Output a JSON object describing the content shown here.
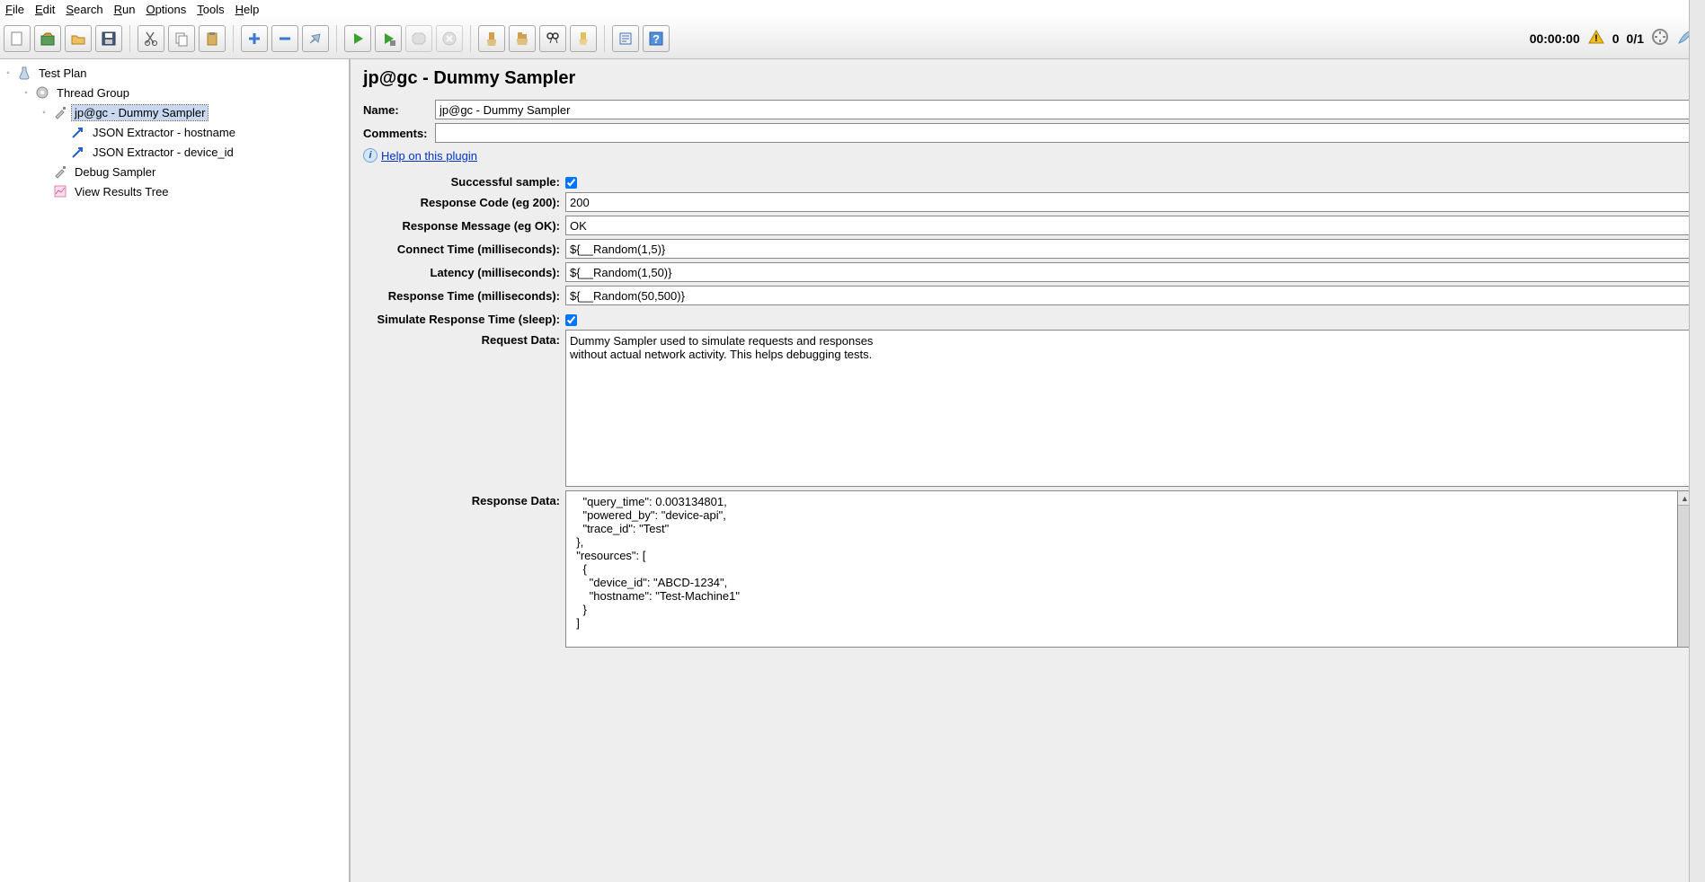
{
  "menubar": [
    "File",
    "Edit",
    "Search",
    "Run",
    "Options",
    "Tools",
    "Help"
  ],
  "status": {
    "time": "00:00:00",
    "warn_count": "0",
    "threads": "0/1"
  },
  "tree": {
    "root": "Test Plan",
    "threadGroup": "Thread Group",
    "dummySampler": "jp@gc - Dummy Sampler",
    "jsonHost": "JSON Extractor - hostname",
    "jsonDevice": "JSON Extractor - device_id",
    "debugSampler": "Debug Sampler",
    "viewResults": "View Results Tree"
  },
  "panel": {
    "title": "jp@gc - Dummy Sampler",
    "nameLabel": "Name:",
    "nameValue": "jp@gc - Dummy Sampler",
    "commentsLabel": "Comments:",
    "commentsValue": "",
    "helpText": "Help on this plugin",
    "successfulLabel": "Successful sample:",
    "responseCodeLabel": "Response Code (eg 200):",
    "responseCodeValue": "200",
    "responseMsgLabel": "Response Message (eg OK):",
    "responseMsgValue": "OK",
    "connectTimeLabel": "Connect Time (milliseconds):",
    "connectTimeValue": "${__Random(1,5)}",
    "latencyLabel": "Latency (milliseconds):",
    "latencyValue": "${__Random(1,50)}",
    "responseTimeLabel": "Response Time (milliseconds):",
    "responseTimeValue": "${__Random(50,500)}",
    "simulateLabel": "Simulate Response Time (sleep):",
    "requestDataLabel": "Request Data:",
    "requestDataValue": "Dummy Sampler used to simulate requests and responses\nwithout actual network activity. This helps debugging tests.",
    "responseDataLabel": "Response Data:",
    "responseDataValue": "    \"query_time\": 0.003134801,\n    \"powered_by\": \"device-api\",\n    \"trace_id\": \"Test\"\n  },\n  \"resources\": [\n    {\n      \"device_id\": \"ABCD-1234\",\n      \"hostname\": \"Test-Machine1\"\n    }\n  ]"
  }
}
